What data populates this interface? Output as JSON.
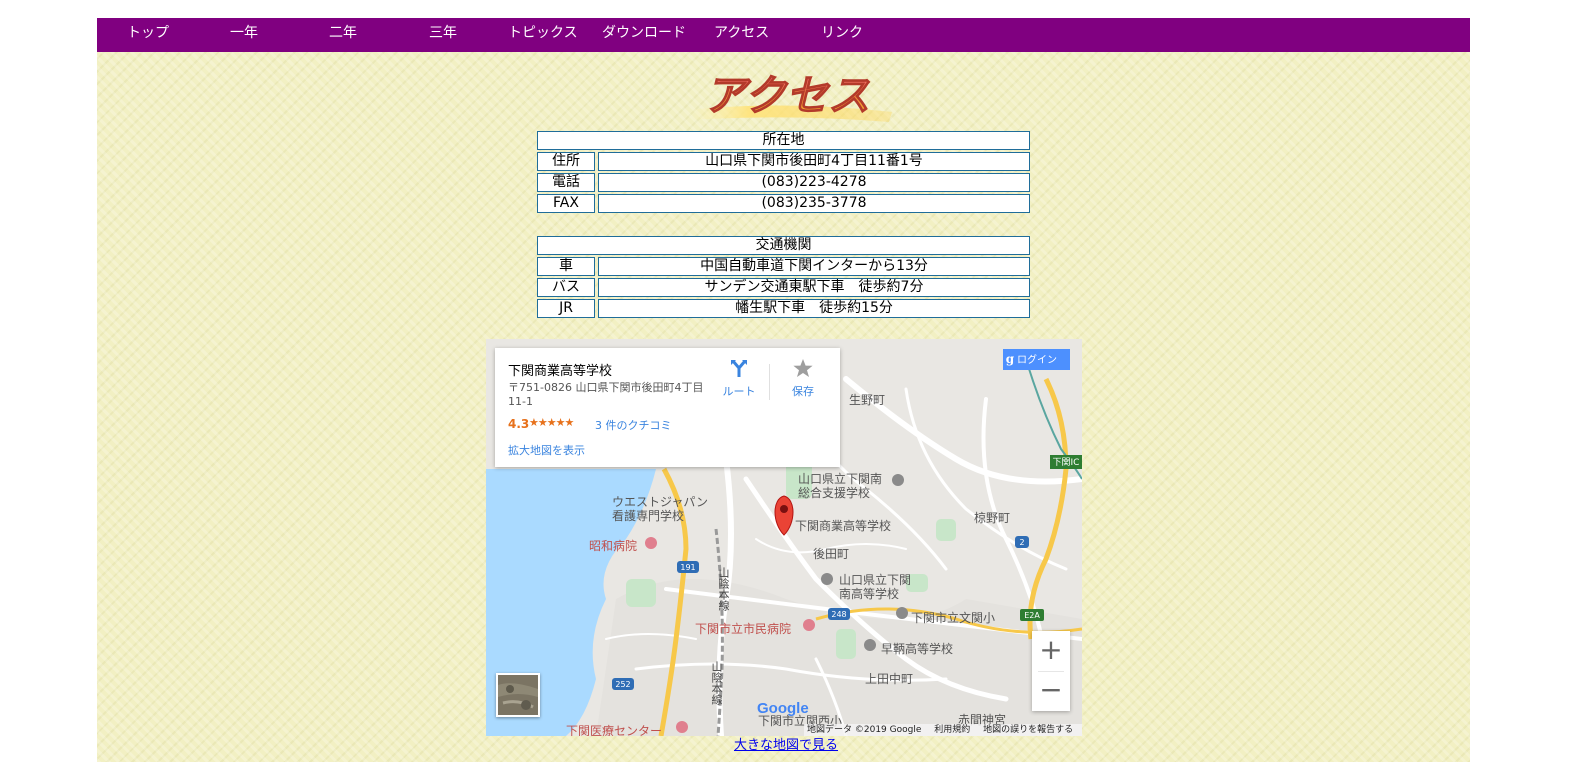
{
  "nav": {
    "items": [
      "トップ",
      "一年",
      "二年",
      "三年",
      "トピックス",
      "ダウンロード",
      "アクセス",
      "リンク"
    ]
  },
  "heading": {
    "text": "アクセス"
  },
  "location": {
    "header": "所在地",
    "rows": [
      {
        "key": "住所",
        "value": "山口県下関市後田町4丁目11番1号"
      },
      {
        "key": "電話",
        "value": "(083)223-4278"
      },
      {
        "key": "FAX",
        "value": "(083)235-3778"
      }
    ]
  },
  "transport": {
    "header": "交通機関",
    "rows": [
      {
        "key": "車",
        "value": "中国自動車道下関インターから13分"
      },
      {
        "key": "バス",
        "value": "サンデン交通東駅下車　徒歩約7分"
      },
      {
        "key": "JR",
        "value": "幡生駅下車　徒歩約15分"
      }
    ]
  },
  "map": {
    "place_name": "下関商業高等学校",
    "address": "〒751-0826 山口県下関市後田町4丁目11-1",
    "rating": "4.3",
    "stars": "★★★★★",
    "reviews": "3 件のクチコミ",
    "larger_map": "拡大地図を表示",
    "route_label": "ルート",
    "save_label": "保存",
    "login": "ログイン",
    "zoom_in": "+",
    "zoom_out": "−",
    "labels": {
      "ikuno": "生野町",
      "shien": "山口県立下関南",
      "shien2": "総合支援学校",
      "west1": "ウエストジャパン",
      "west2": "看護専門学校",
      "showa": "昭和病院",
      "marker": "下関商業高等学校",
      "ushiroda": "後田町",
      "mukunoki": "椋野町",
      "minami1": "山口県立下関",
      "minami2": "南高等学校",
      "bunkan": "下関市立文関小",
      "shimin": "下関市立市民病院",
      "hayatomo": "早鞆高等学校",
      "kamitanaka": "上田中町",
      "iryo": "下関医療センター",
      "kanmon": "下関市立関西小",
      "akama": "赤間神宮",
      "ic": "下関IC",
      "sanin1": "山陰本線",
      "sanin2": "山陰本線"
    },
    "route_numbers": [
      "191",
      "248",
      "252",
      "2",
      "E2A"
    ],
    "google": "Google",
    "footer": {
      "data": "地図データ ©2019 Google",
      "terms": "利用規約",
      "report": "地図の誤りを報告する"
    }
  },
  "larger_map_link": "大きな地図で見る",
  "colors": {
    "nav_bg": "#800080",
    "page_bg": "#f2f0c3",
    "table_border": "#1f6d9a",
    "link_blue": "#3a84df",
    "marker_red": "#ea4335"
  }
}
